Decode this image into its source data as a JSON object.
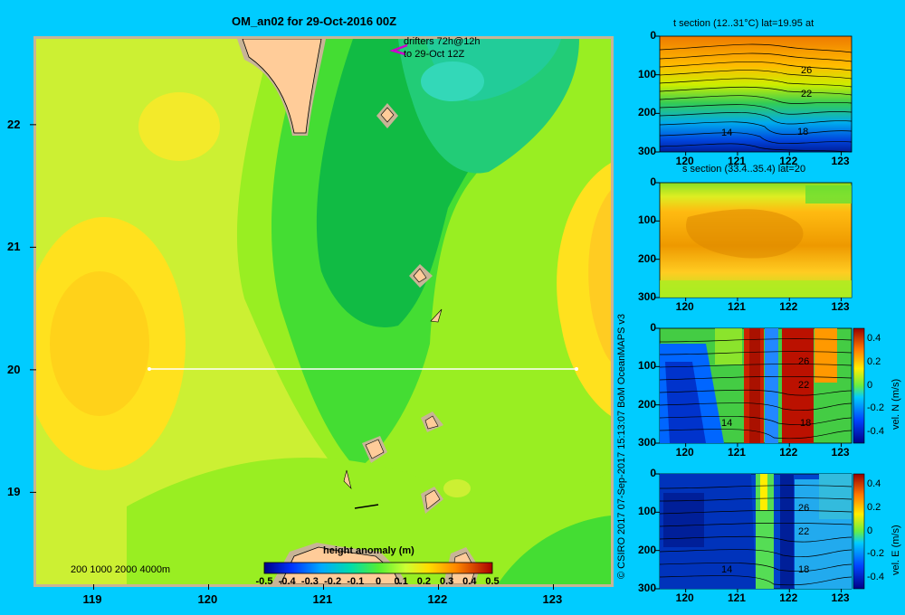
{
  "main_map": {
    "title": "OM_an02 for 29-Oct-2016 00Z",
    "drifter_note_line1": "drifters 72h@12h",
    "drifter_note_line2": "to 29-Oct 12Z",
    "depth_legend": "200 1000 2000 4000m",
    "colorbar_title": "height anomaly (m)",
    "colorbar_ticks": [
      "-0.5",
      "-0.4",
      "-0.3",
      "-0.2",
      "-0.1",
      "0",
      "0.1",
      "0.2",
      "0.3",
      "0.4",
      "0.5"
    ],
    "lon_ticks": [
      "119",
      "120",
      "121",
      "122",
      "123"
    ],
    "lat_ticks": [
      "22",
      "21",
      "20",
      "19"
    ]
  },
  "credit": "© CSIRO 2017   07-Sep-2017 15:13:07 BoM OceanMAPS v3",
  "panels": {
    "t_section": {
      "title": "t section (12..31°C) lat=19.95 at",
      "contour_labels": [
        "26",
        "22",
        "18",
        "14"
      ]
    },
    "s_section": {
      "title": "s section (33.4..35.4) lat=20"
    },
    "v_section": {
      "cbar_label": "vel. N (m/s)",
      "contour_labels": [
        "26",
        "22",
        "18",
        "14"
      ]
    },
    "u_section": {
      "cbar_label": "vel. E (m/s)",
      "contour_labels": [
        "26",
        "22",
        "18",
        "14"
      ]
    },
    "depth_ticks": [
      "0",
      "100",
      "200",
      "300"
    ],
    "lon_ticks": [
      "120",
      "121",
      "122",
      "123"
    ],
    "vel_cbar_ticks": [
      "0.4",
      "0.2",
      "0",
      "-0.2",
      "-0.4"
    ]
  },
  "chart_data": [
    {
      "type": "heatmap",
      "title": "OM_an02 for 29-Oct-2016 00Z",
      "xlabel": "",
      "ylabel": "",
      "xlim": [
        118.5,
        123.5
      ],
      "ylim": [
        18.25,
        22.7
      ],
      "x_ticks": [
        119,
        120,
        121,
        122,
        123
      ],
      "y_ticks": [
        19,
        20,
        21,
        22
      ],
      "colorbar": {
        "label": "height anomaly (m)",
        "range": [
          -0.5,
          0.5
        ]
      },
      "section_line": {
        "lat": 20,
        "lon_start": 119.5,
        "lon_end": 123.2
      }
    },
    {
      "type": "heatmap",
      "title": "t section (12..31°C) lat=19.95 at",
      "xlim": [
        119.5,
        123.2
      ],
      "ylim": [
        300,
        0
      ],
      "contour_labels": [
        26,
        22,
        18,
        14
      ]
    },
    {
      "type": "heatmap",
      "title": "s section (33.4..35.4) lat=20",
      "xlim": [
        119.5,
        123.2
      ],
      "ylim": [
        300,
        0
      ]
    },
    {
      "type": "heatmap",
      "title": "",
      "colorbar_label": "vel. N (m/s)",
      "crange": [
        -0.4,
        0.4
      ],
      "xlim": [
        119.5,
        123.2
      ],
      "ylim": [
        300,
        0
      ]
    },
    {
      "type": "heatmap",
      "title": "",
      "colorbar_label": "vel. E (m/s)",
      "crange": [
        -0.4,
        0.4
      ],
      "xlim": [
        119.5,
        123.2
      ],
      "ylim": [
        300,
        0
      ]
    }
  ]
}
